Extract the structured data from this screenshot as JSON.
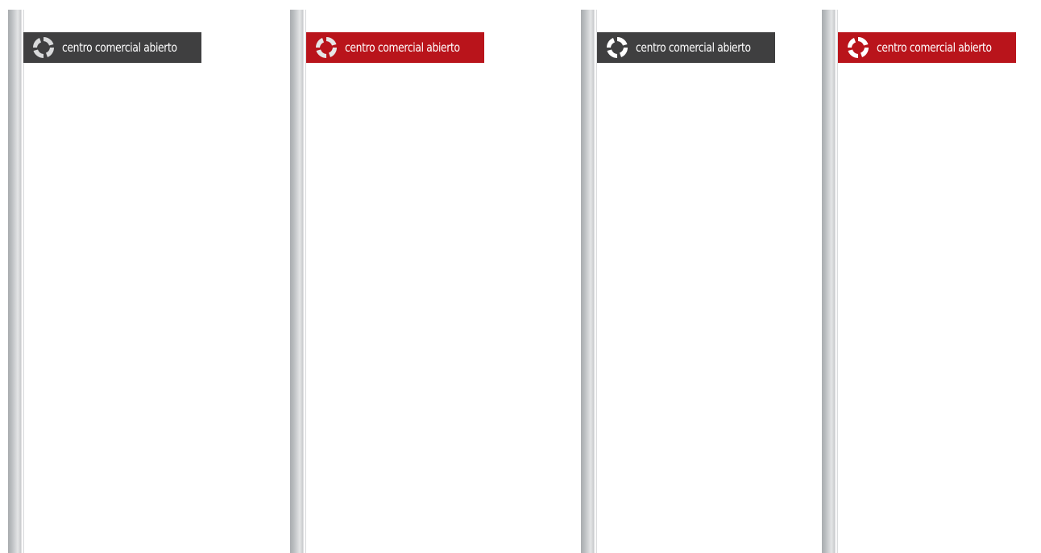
{
  "panels": [
    {
      "label": "centro comercial abierto",
      "variant": "dark",
      "color": "#3f3f40"
    },
    {
      "label": "centro comercial abierto",
      "variant": "red",
      "color": "#b9141b"
    },
    {
      "label": "centro comercial abierto",
      "variant": "dark",
      "color": "#3f3f40"
    },
    {
      "label": "centro comercial abierto",
      "variant": "red",
      "color": "#b9141b"
    }
  ],
  "logo_icon": "swirl-ring-icon"
}
